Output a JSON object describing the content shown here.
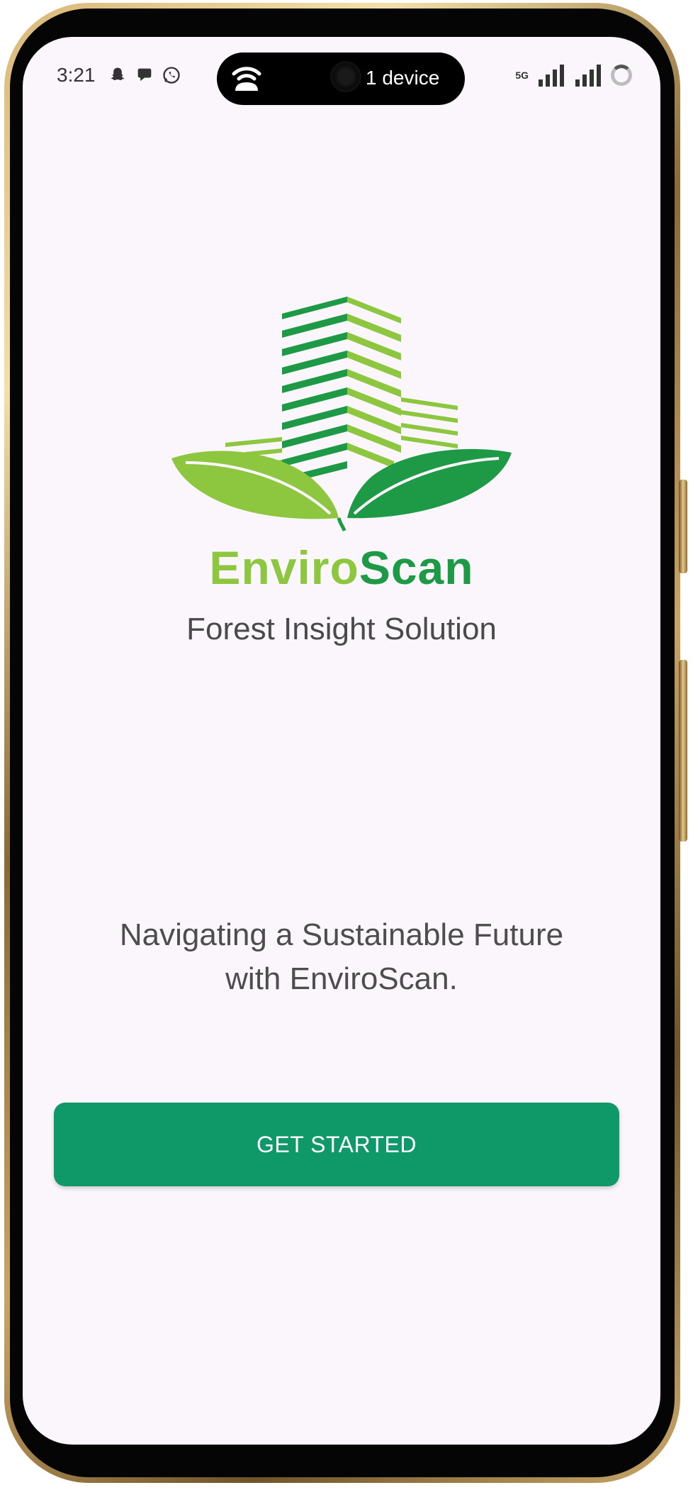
{
  "status_bar": {
    "time": "3:21",
    "notification_icons": [
      "snapchat-icon",
      "chat-bubble-icon",
      "whatsapp-icon"
    ],
    "island_label": "1 device",
    "network_label": "5G",
    "icons": [
      "hotspot-icon",
      "signal-icon",
      "signal-icon",
      "loading-ring-icon"
    ]
  },
  "brand": {
    "name_part1": "Enviro",
    "name_part2": "Scan",
    "tagline": "Forest Insight Solution",
    "colors": {
      "light_green": "#8dc63f",
      "dark_green": "#1e9a47"
    }
  },
  "mission": {
    "line1": "Navigating a Sustainable Future",
    "line2": "with EnviroScan."
  },
  "cta": {
    "label": "GET STARTED",
    "color": "#0f9968"
  },
  "screen": {
    "background": "#fbf6fb"
  }
}
